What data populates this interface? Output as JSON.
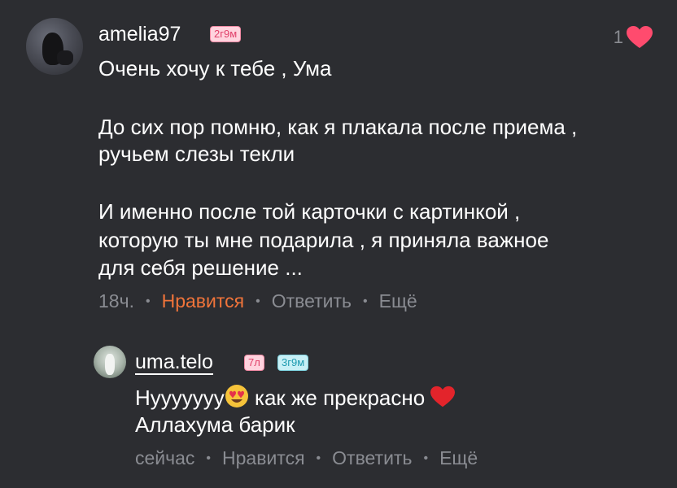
{
  "comment": {
    "username": "amelia97",
    "badge": "2г9м",
    "like_count": "1",
    "lines": [
      "Очень хочу к тебе , Ума",
      "",
      "До сих пор помню, как я плакала после приема ,",
      "ручьем слезы текли",
      "",
      "И именно после той карточки с картинкой ,",
      "которую ты мне подарила , я приняла важное",
      "для себя решение ..."
    ],
    "actions": {
      "time": "18ч.",
      "like": "Нравится",
      "reply": "Ответить",
      "more": "Ещё"
    }
  },
  "reply": {
    "username": "uma.telo",
    "badge1": "7л",
    "badge2": "3г9м",
    "line1_a": "Нуууууyy",
    "line1_b": " как же прекрасно ",
    "line2": "Аллахума барик",
    "actions": {
      "time": "сейчас",
      "like": "Нравится",
      "reply": "Ответить",
      "more": "Ещё"
    }
  },
  "colors": {
    "background": "#2c2d31",
    "accent_like": "#f0743a",
    "heart": "#ff4b6e",
    "muted": "#8a8c92"
  }
}
